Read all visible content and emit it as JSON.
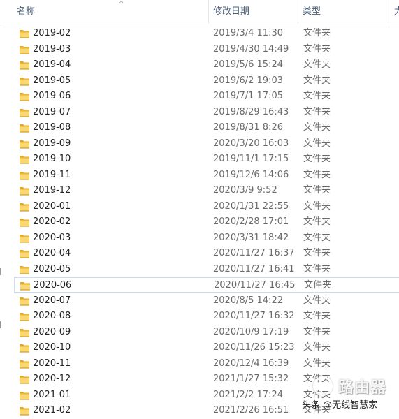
{
  "columns": {
    "name": "名称",
    "date_modified": "修改日期",
    "type": "类型",
    "size": "大"
  },
  "sort_indicator": "^",
  "rows": [
    {
      "name": "2019-02",
      "date": "2019/3/4 11:30",
      "type": "文件夹"
    },
    {
      "name": "2019-03",
      "date": "2019/4/30 14:49",
      "type": "文件夹"
    },
    {
      "name": "2019-04",
      "date": "2019/5/6 15:24",
      "type": "文件夹"
    },
    {
      "name": "2019-05",
      "date": "2019/6/2 19:03",
      "type": "文件夹"
    },
    {
      "name": "2019-06",
      "date": "2019/7/1 17:05",
      "type": "文件夹"
    },
    {
      "name": "2019-07",
      "date": "2019/8/29 16:43",
      "type": "文件夹"
    },
    {
      "name": "2019-08",
      "date": "2019/8/31 8:26",
      "type": "文件夹"
    },
    {
      "name": "2019-09",
      "date": "2020/3/20 16:03",
      "type": "文件夹"
    },
    {
      "name": "2019-10",
      "date": "2019/11/1 17:15",
      "type": "文件夹"
    },
    {
      "name": "2019-11",
      "date": "2019/12/6 14:06",
      "type": "文件夹"
    },
    {
      "name": "2019-12",
      "date": "2020/3/9 9:52",
      "type": "文件夹"
    },
    {
      "name": "2020-01",
      "date": "2020/1/31 22:55",
      "type": "文件夹"
    },
    {
      "name": "2020-02",
      "date": "2020/2/28 17:01",
      "type": "文件夹"
    },
    {
      "name": "2020-03",
      "date": "2020/3/31 18:42",
      "type": "文件夹"
    },
    {
      "name": "2020-04",
      "date": "2020/11/27 16:37",
      "type": "文件夹"
    },
    {
      "name": "2020-05",
      "date": "2020/11/27 16:41",
      "type": "文件夹"
    },
    {
      "name": "2020-06",
      "date": "2020/11/27 16:45",
      "type": "文件夹",
      "selected": true
    },
    {
      "name": "2020-07",
      "date": "2020/8/5 14:22",
      "type": "文件夹"
    },
    {
      "name": "2020-08",
      "date": "2020/11/27 16:32",
      "type": "文件夹"
    },
    {
      "name": "2020-09",
      "date": "2020/10/9 17:19",
      "type": "文件夹"
    },
    {
      "name": "2020-10",
      "date": "2020/11/26 15:23",
      "type": "文件夹"
    },
    {
      "name": "2020-11",
      "date": "2020/12/4 16:39",
      "type": "文件夹"
    },
    {
      "name": "2020-12",
      "date": "2021/1/27 15:32",
      "type": "文件夹"
    },
    {
      "name": "2021-01",
      "date": "2021/2/2 17:24",
      "type": "文件夹"
    },
    {
      "name": "2021-02",
      "date": "2021/2/26 16:51",
      "type": "文件夹"
    }
  ],
  "watermark": {
    "logo_text": "路由器",
    "credit": "头条 @无线智慧家"
  },
  "icons": {
    "folder": "folder-icon",
    "sort": "sort-ascending-icon"
  },
  "colors": {
    "folder_body": "#f3c44c",
    "folder_front": "#f9d873",
    "header_text": "#4c607a",
    "selection_border": "#c6dff5"
  }
}
